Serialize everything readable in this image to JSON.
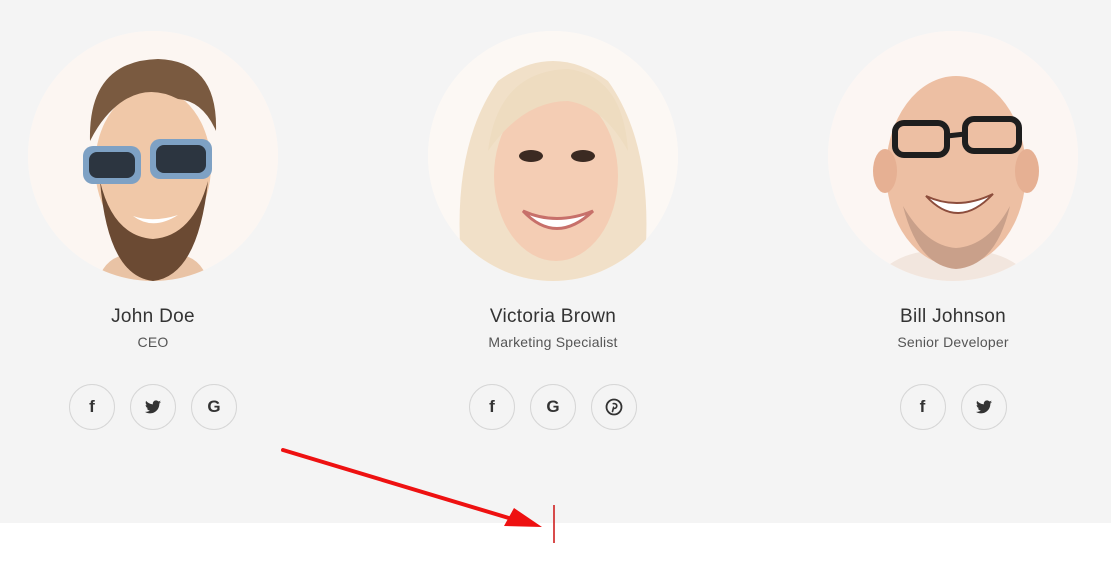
{
  "team": {
    "members": [
      {
        "name": "John Doe",
        "role": "CEO",
        "socials": [
          "facebook-icon",
          "twitter-icon",
          "google-icon"
        ]
      },
      {
        "name": "Victoria Brown",
        "role": "Marketing Specialist",
        "socials": [
          "facebook-icon",
          "google-icon",
          "pinterest-icon"
        ]
      },
      {
        "name": "Bill Johnson",
        "role": "Senior Developer",
        "socials": [
          "facebook-icon",
          "twitter-icon"
        ]
      }
    ]
  },
  "glyphs": {
    "facebook": "f",
    "google": "G"
  },
  "colors": {
    "section_background": "#f4f4f4",
    "page_background": "#ffffff",
    "annotation_arrow": "#ee1111"
  }
}
